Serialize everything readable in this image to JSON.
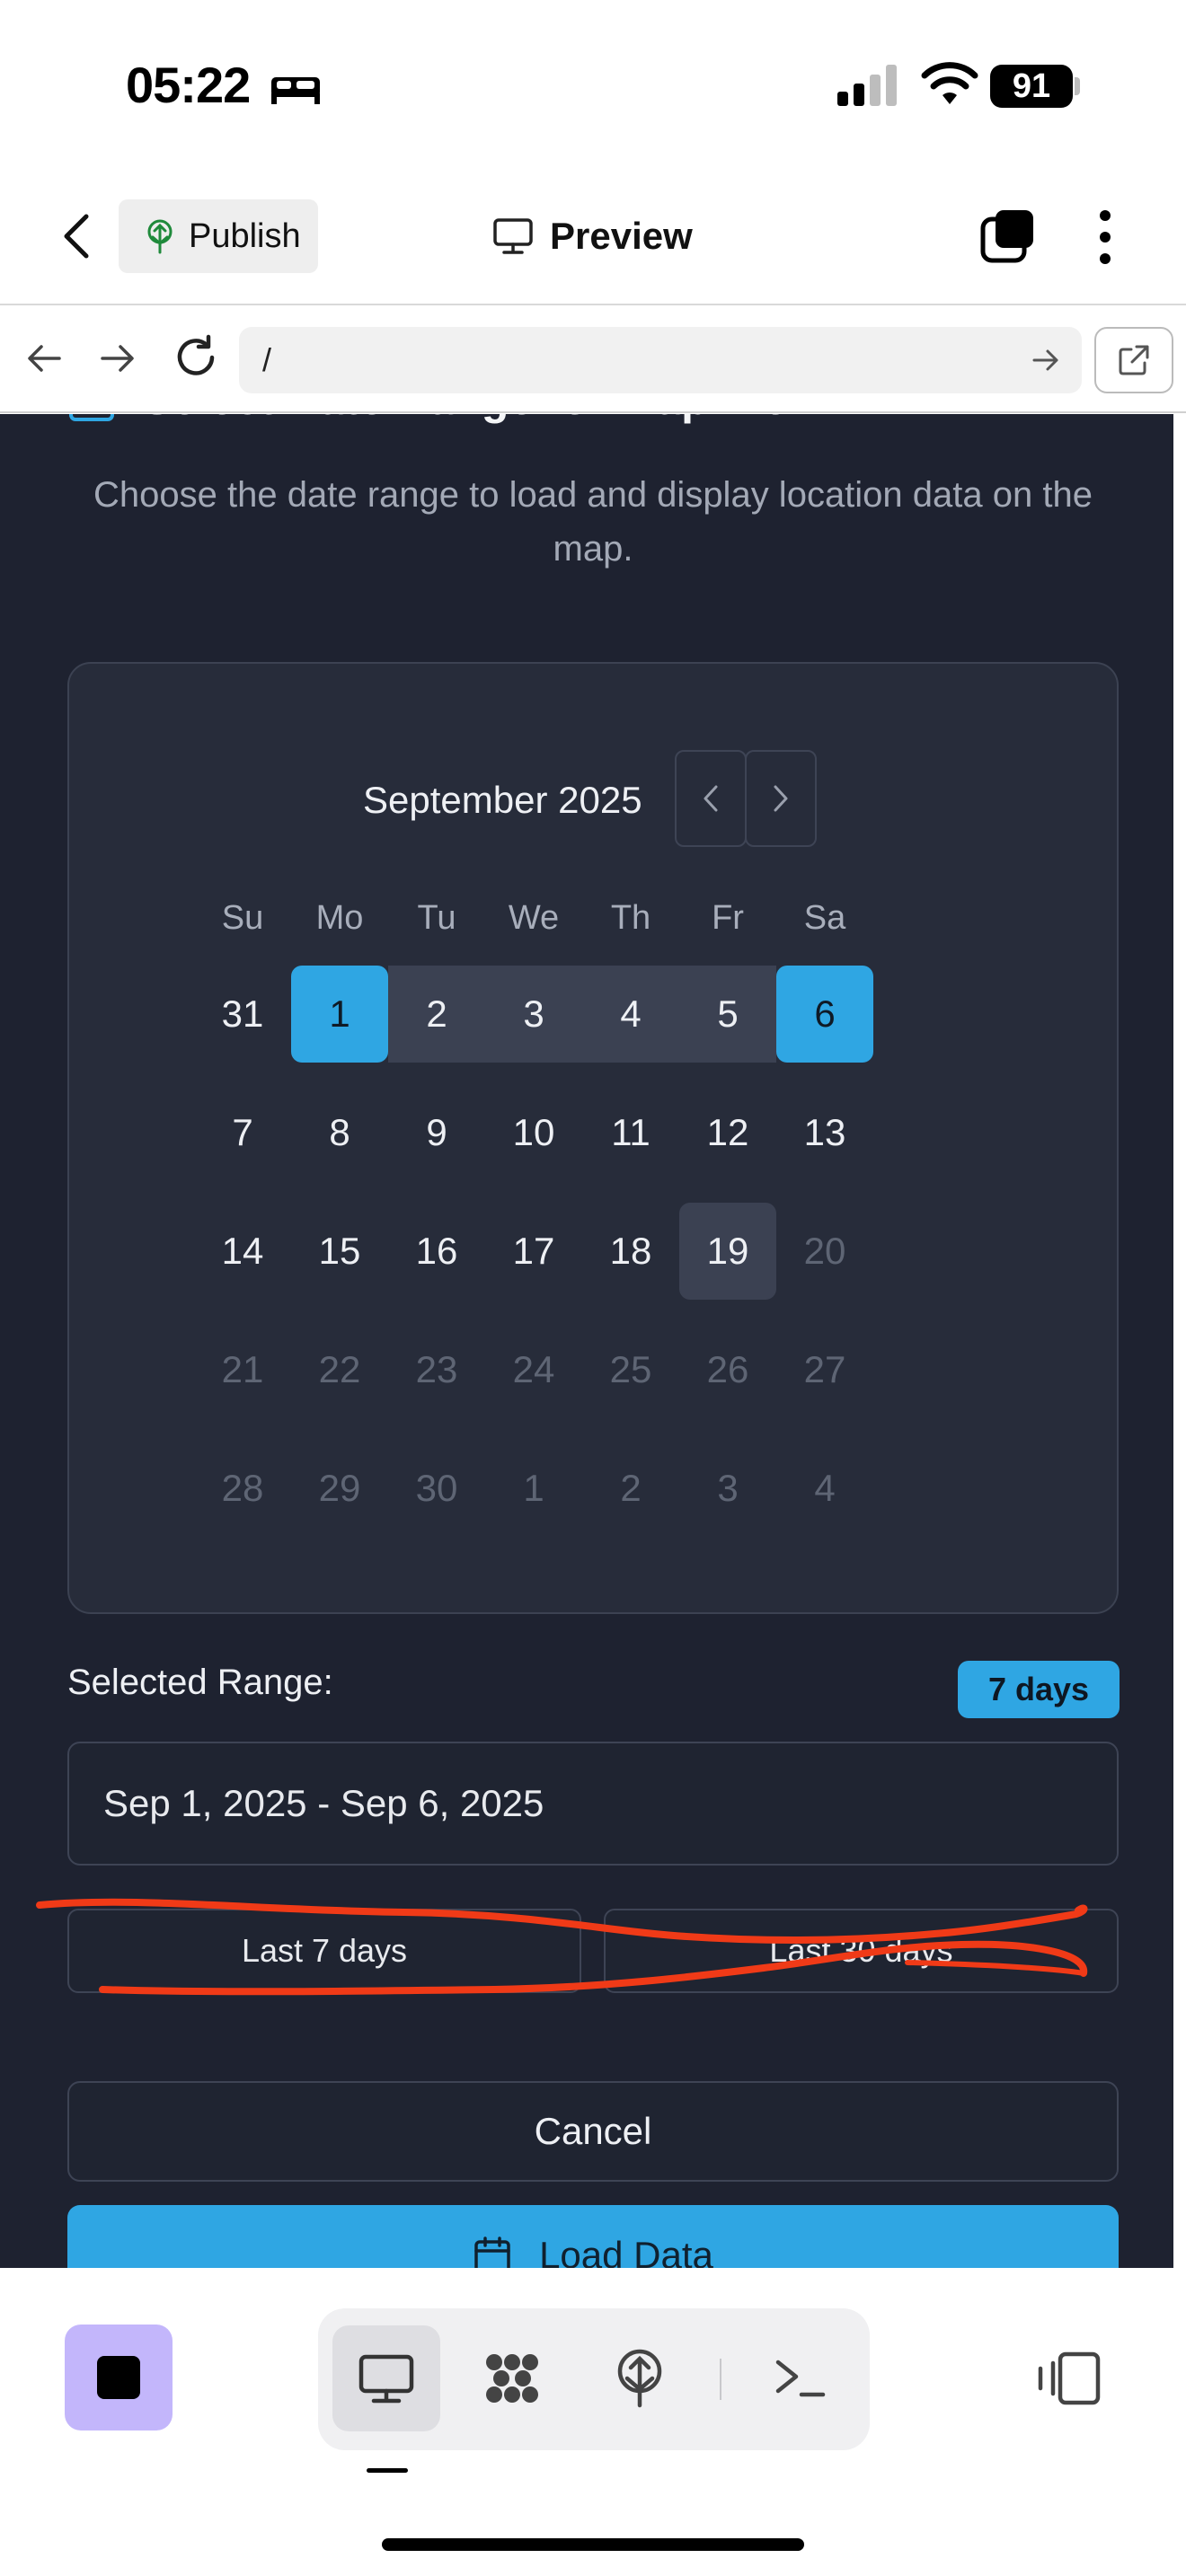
{
  "status_bar": {
    "time": "05:22",
    "battery": "91"
  },
  "header": {
    "publish_label": "Publish",
    "preview_label": "Preview"
  },
  "browser": {
    "url": "/"
  },
  "dialog": {
    "title": "Select Date Range for Map View",
    "description": "Choose the date range to load and display location data on the map."
  },
  "calendar": {
    "caption": "September 2025",
    "weekdays": [
      "Su",
      "Mo",
      "Tu",
      "We",
      "Th",
      "Fr",
      "Sa"
    ],
    "weeks": [
      [
        "31",
        "1",
        "2",
        "3",
        "4",
        "5",
        "6"
      ],
      [
        "7",
        "8",
        "9",
        "10",
        "11",
        "12",
        "13"
      ],
      [
        "14",
        "15",
        "16",
        "17",
        "18",
        "19",
        "20"
      ],
      [
        "21",
        "22",
        "23",
        "24",
        "25",
        "26",
        "27"
      ],
      [
        "28",
        "29",
        "30",
        "1",
        "2",
        "3",
        "4"
      ]
    ],
    "range_start": "1",
    "range_end": "6",
    "today": "19"
  },
  "selection": {
    "label": "Selected Range:",
    "badge": "7 days",
    "value": "Sep 1, 2025 - Sep 6, 2025"
  },
  "quick_ranges": {
    "last7": "Last 7 days",
    "last30": "Last 30 days"
  },
  "actions": {
    "cancel": "Cancel",
    "load": "Load Data"
  },
  "colors": {
    "accent": "#2fa6e3",
    "dialog_bg": "#1e2230",
    "calendar_bg": "#272c3a",
    "annotation": "#f03a17",
    "stop_button": "#c3b6fb"
  },
  "icons": {
    "status": [
      "bed-icon",
      "signal-icon",
      "wifi-icon"
    ],
    "header": [
      "back-icon",
      "publish-tree-icon",
      "monitor-icon",
      "tabs-icon",
      "more-icon"
    ],
    "browser": [
      "back-arrow-icon",
      "forward-arrow-icon",
      "reload-icon",
      "go-arrow-icon",
      "open-external-icon"
    ],
    "toolbar": [
      "stop-icon",
      "monitor-icon",
      "cloud-nodes-icon",
      "publish-tree-icon",
      "terminal-icon",
      "panel-toggle-icon"
    ]
  }
}
